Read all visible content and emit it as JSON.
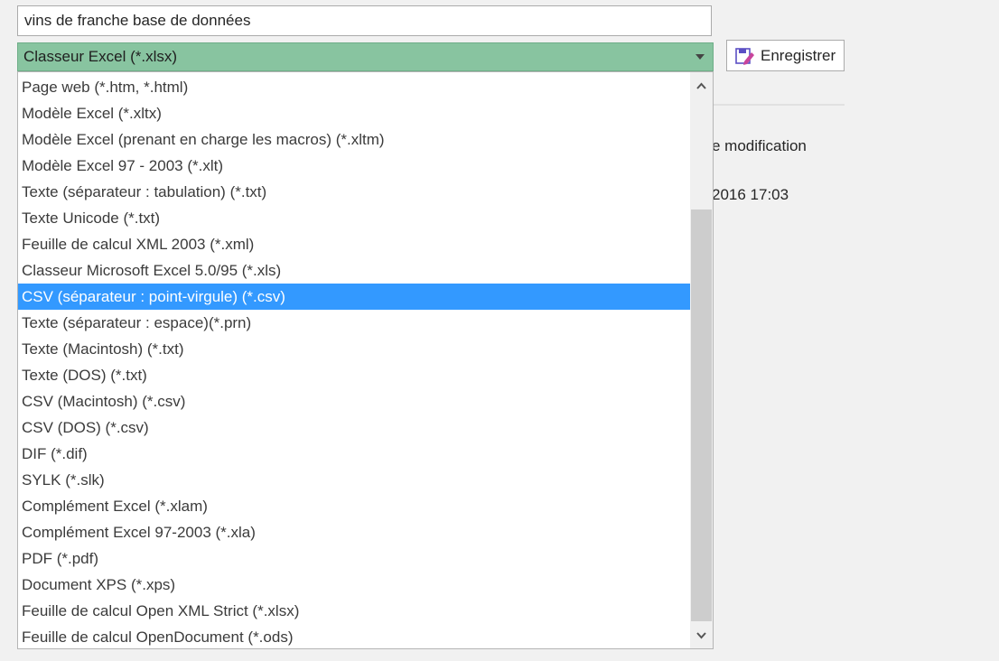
{
  "file_name": {
    "value": "vins de franche base de données"
  },
  "format_select": {
    "selected": "Classeur Excel (*.xlsx)"
  },
  "save_button": {
    "label": "Enregistrer",
    "icon": "save-edit-icon"
  },
  "background": {
    "modified_label_fragment": "e modification",
    "date_fragment": "2016 17:03"
  },
  "dropdown": {
    "selected_index": 8,
    "items": [
      "Page web (*.htm, *.html)",
      "Modèle Excel (*.xltx)",
      "Modèle Excel (prenant en charge les macros) (*.xltm)",
      "Modèle Excel 97 - 2003 (*.xlt)",
      "Texte (séparateur : tabulation) (*.txt)",
      "Texte Unicode (*.txt)",
      "Feuille de calcul XML 2003 (*.xml)",
      "Classeur Microsoft Excel 5.0/95 (*.xls)",
      "CSV (séparateur : point-virgule) (*.csv)",
      "Texte (séparateur : espace)(*.prn)",
      "Texte (Macintosh) (*.txt)",
      "Texte (DOS) (*.txt)",
      "CSV (Macintosh) (*.csv)",
      "CSV (DOS) (*.csv)",
      "DIF (*.dif)",
      "SYLK (*.slk)",
      "Complément Excel (*.xlam)",
      "Complément Excel 97-2003 (*.xla)",
      "PDF (*.pdf)",
      "Document XPS (*.xps)",
      "Feuille de calcul Open XML Strict (*.xlsx)",
      "Feuille de calcul OpenDocument (*.ods)"
    ]
  },
  "colors": {
    "select_bg": "#88c4a0",
    "highlight": "#3399ff"
  }
}
